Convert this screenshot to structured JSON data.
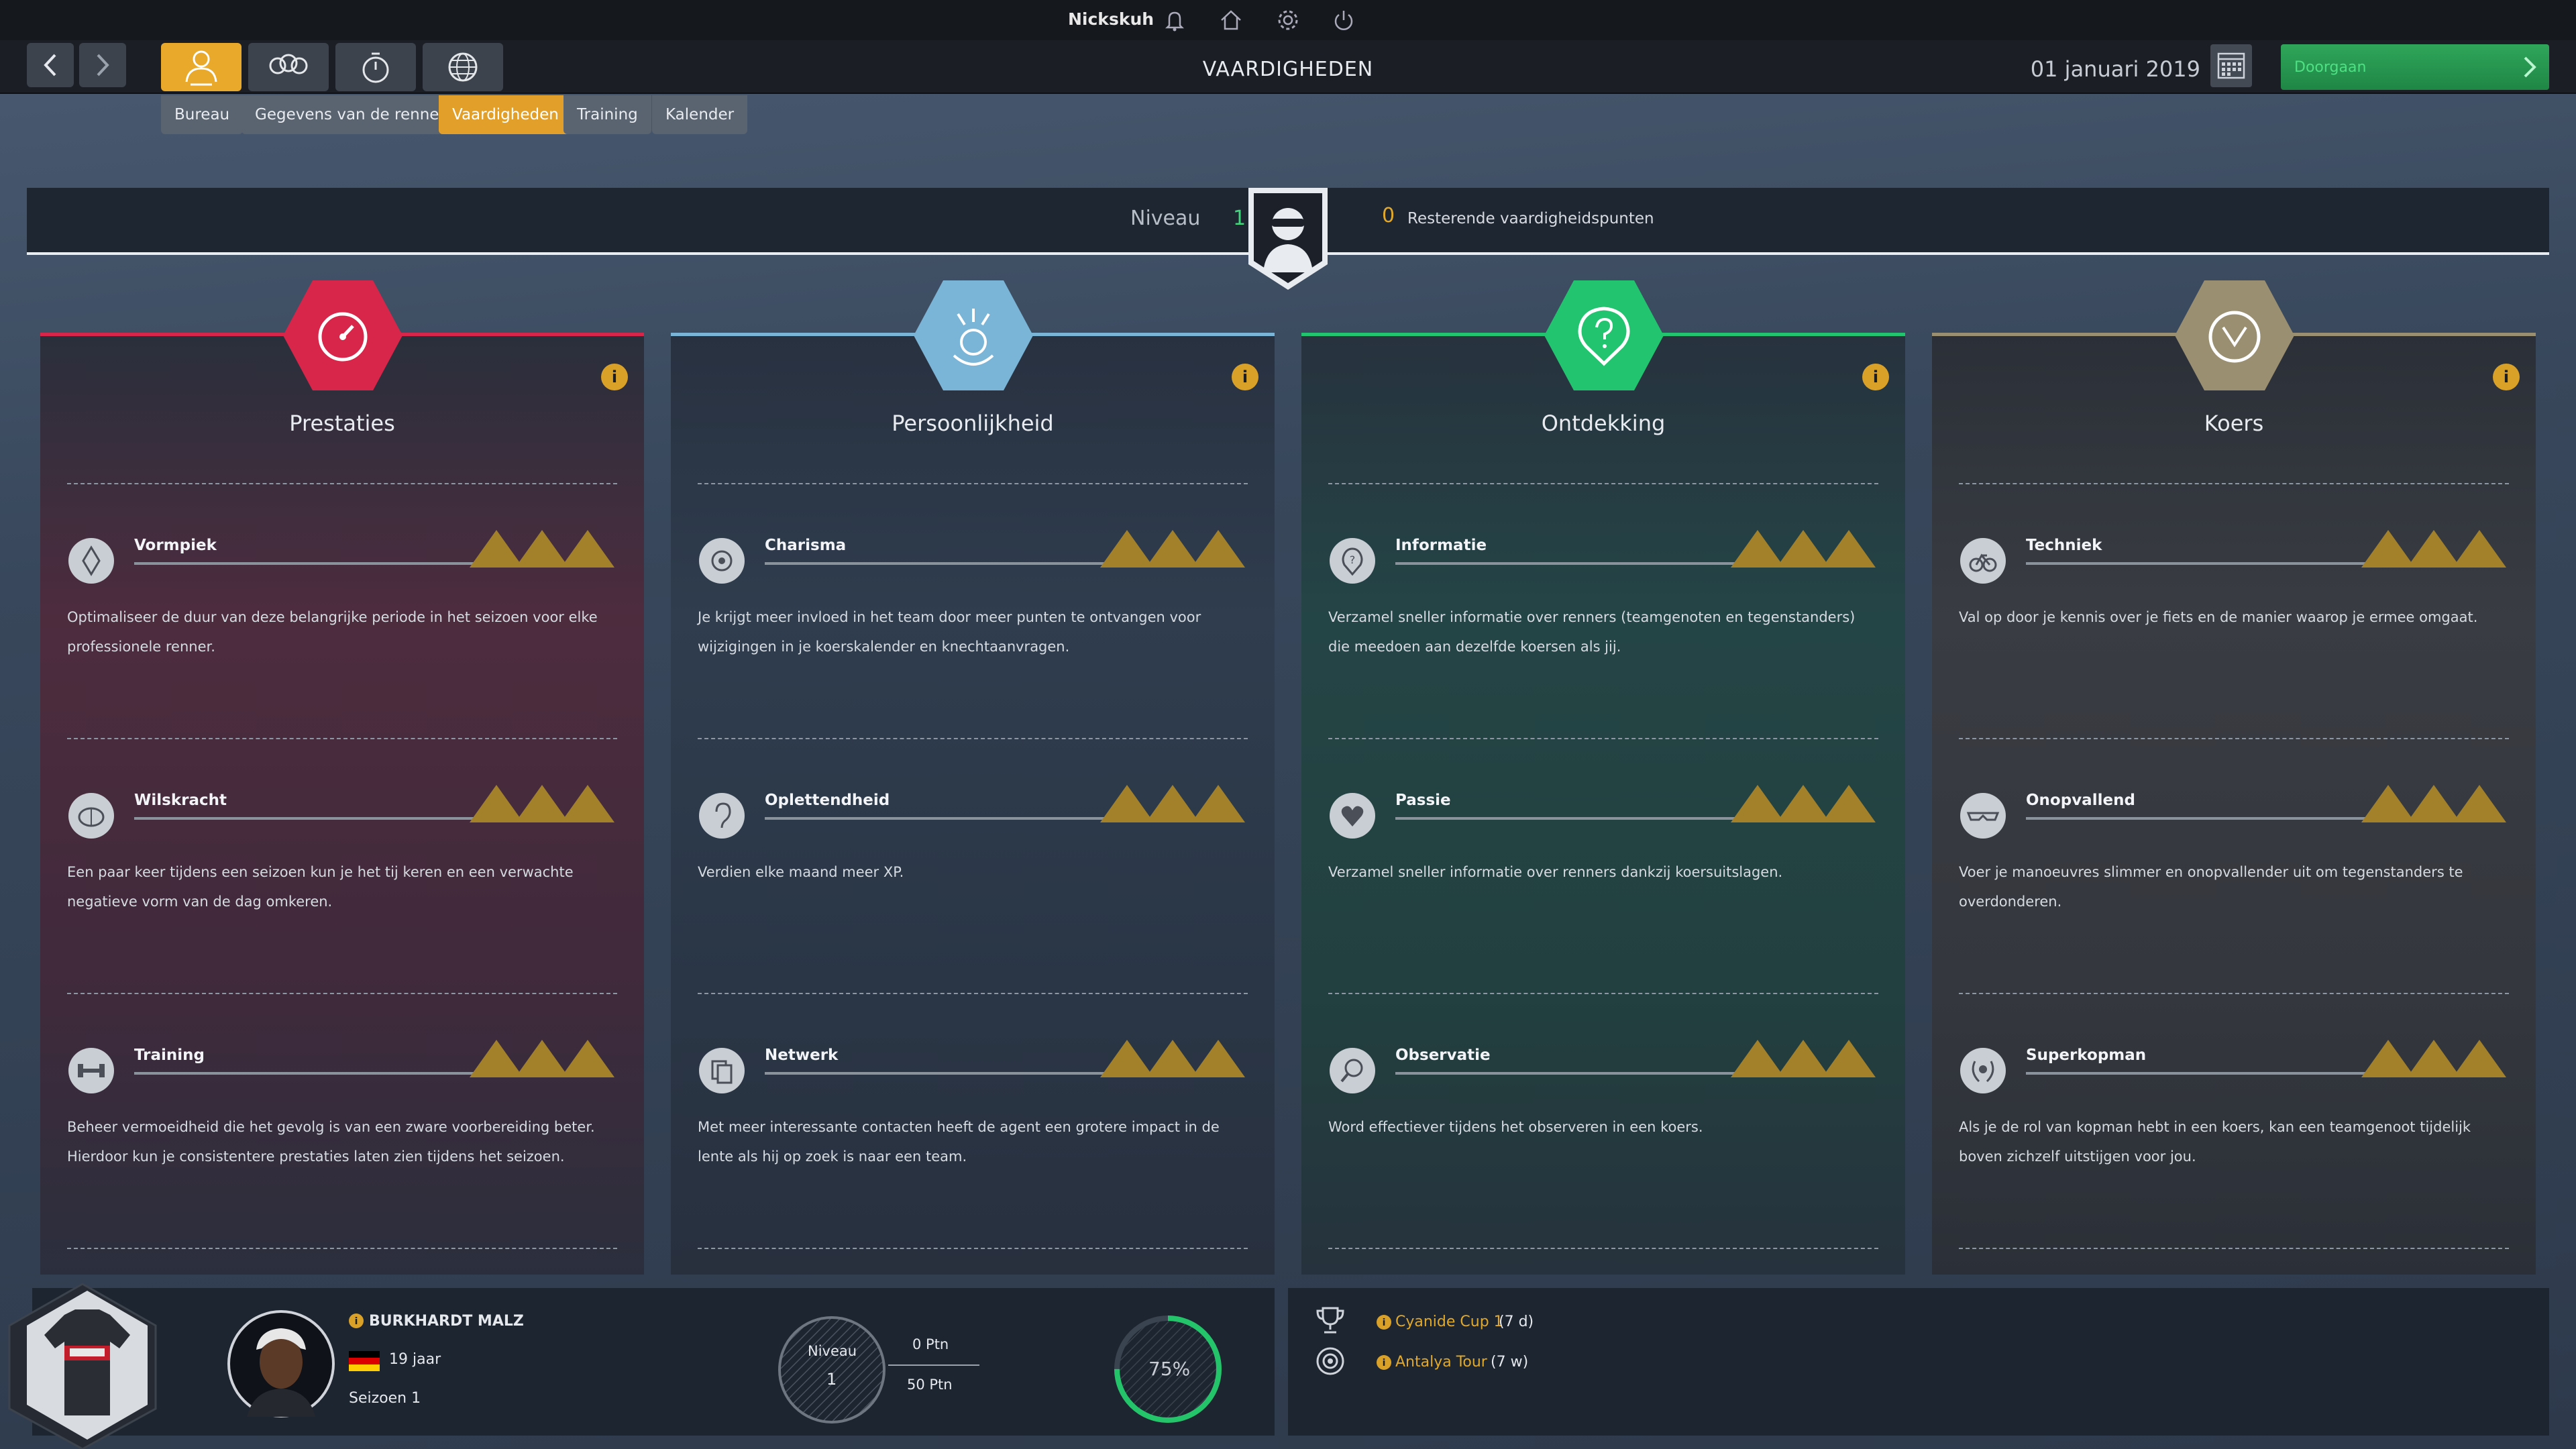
{
  "topbar": {
    "username": "Nickskuh",
    "icons": [
      "bell-icon",
      "home-icon",
      "gear-icon",
      "power-icon"
    ]
  },
  "nav": {
    "page_title": "VAARDIGHEDEN",
    "date": "01 januari 2019",
    "continue_label": "Doorgaan",
    "subtabs": [
      "Bureau",
      "Gegevens van de renner",
      "Vaardigheden",
      "Training",
      "Kalender"
    ],
    "active_subtab": "Vaardigheden"
  },
  "banner": {
    "level_label": "Niveau",
    "level_value": "1",
    "points_value": "0",
    "points_label": "Resterende vaardigheidspunten"
  },
  "cards": [
    {
      "title": "Prestaties",
      "color": "#d7264a",
      "skills": [
        {
          "name": "Vormpiek",
          "desc": "Optimaliseer de duur van deze belangrijke periode in het seizoen voor elke professionele renner."
        },
        {
          "name": "Wilskracht",
          "desc": "Een paar keer tijdens een seizoen kun je het tij keren en een verwachte negatieve vorm van de dag omkeren."
        },
        {
          "name": "Training",
          "desc": "Beheer vermoeidheid die het gevolg is van een zware voorbereiding beter. Hierdoor kun je consistentere prestaties laten zien tijdens het seizoen."
        }
      ]
    },
    {
      "title": "Persoonlijkheid",
      "color": "#7ab4d6",
      "skills": [
        {
          "name": "Charisma",
          "desc": "Je krijgt meer invloed in het team door meer punten te ontvangen voor wijzigingen in je koerskalender en knechtaanvragen."
        },
        {
          "name": "Oplettendheid",
          "desc": "Verdien elke maand meer XP."
        },
        {
          "name": "Netwerk",
          "desc": "Met meer interessante contacten heeft de agent een grotere impact in de lente als hij op zoek is naar een team."
        }
      ]
    },
    {
      "title": "Ontdekking",
      "color": "#22c46f",
      "skills": [
        {
          "name": "Informatie",
          "desc": "Verzamel sneller informatie over renners (teamgenoten en tegenstanders) die meedoen aan dezelfde koersen als jij."
        },
        {
          "name": "Passie",
          "desc": "Verzamel sneller informatie over renners dankzij koersuitslagen."
        },
        {
          "name": "Observatie",
          "desc": "Word effectiever tijdens het observeren in een koers."
        }
      ]
    },
    {
      "title": "Koers",
      "color": "#9b8f72",
      "skills": [
        {
          "name": "Techniek",
          "desc": "Val op door je kennis over je fiets en de manier waarop je ermee omgaat."
        },
        {
          "name": "Onopvallend",
          "desc": "Voer je manoeuvres slimmer en onopvallender uit om tegenstanders te overdonderen."
        },
        {
          "name": "Superkopman",
          "desc": "Als je de rol van kopman hebt in een koers, kan een teamgenoot tijdelijk boven zichzelf uitstijgen voor jou."
        }
      ]
    }
  ],
  "rider": {
    "name": "BURKHARDT MALZ",
    "age": "19 jaar",
    "season": "Seizoen 1",
    "level_label": "Niveau",
    "level_value": "1",
    "points_current": "0 Ptn",
    "points_next": "50 Ptn",
    "progress_label": "75%",
    "progress": 0.75
  },
  "events": [
    {
      "name": "Cyanide Cup 1",
      "when": "(7 d)"
    },
    {
      "name": "Antalya Tour",
      "when": "(7 w)"
    }
  ]
}
